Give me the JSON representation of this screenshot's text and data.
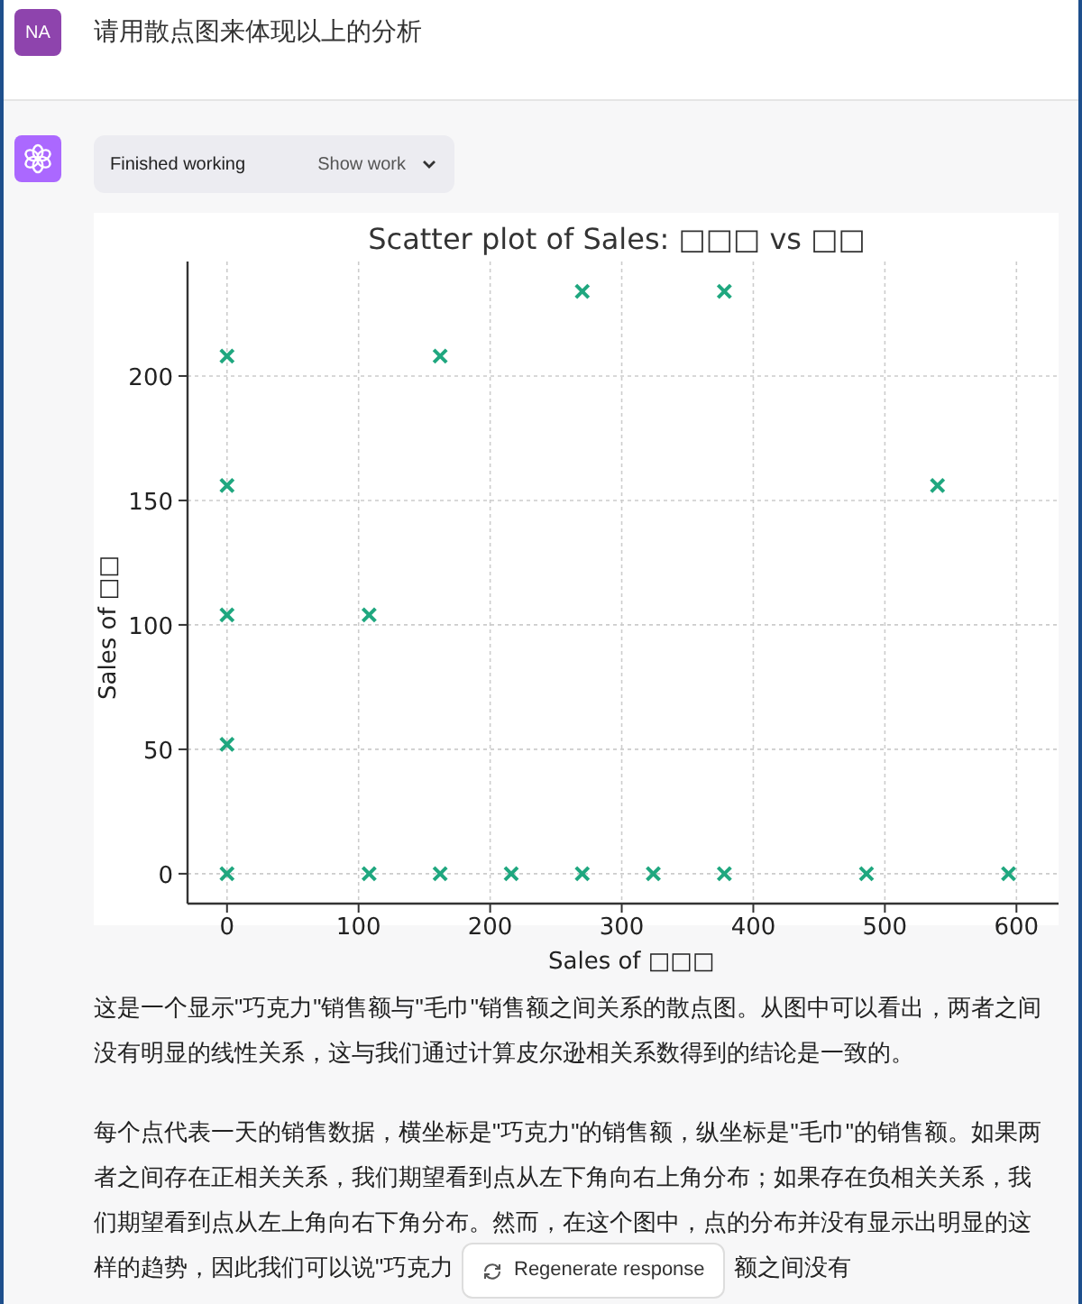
{
  "user_message": {
    "avatar": "NA",
    "text": "请用散点图来体现以上的分析"
  },
  "assistant": {
    "status": {
      "label": "Finished working",
      "toggle": "Show work",
      "expanded": false
    },
    "chart_data": {
      "type": "scatter",
      "title": "Scatter plot of Sales: □□□ vs □□",
      "xlabel": "Sales of □□□",
      "ylabel": "Sales of □□",
      "xlim": [
        -30,
        632
      ],
      "ylim": [
        -12,
        246
      ],
      "xticks": [
        0,
        100,
        200,
        300,
        400,
        500,
        600
      ],
      "yticks": [
        0,
        50,
        100,
        150,
        200
      ],
      "grid": true,
      "x": [
        0,
        0,
        0,
        0,
        0,
        108,
        108,
        162,
        162,
        216,
        270,
        270,
        324,
        378,
        378,
        486,
        540,
        594
      ],
      "series": [
        {
          "color": "#1fa77f",
          "values": [
            208,
            156,
            104,
            52,
            0,
            104,
            0,
            208,
            0,
            0,
            234,
            0,
            0,
            234,
            0,
            0,
            156,
            0
          ]
        }
      ]
    },
    "paragraphs": [
      {
        "lines": [
          [
            "这是一个显示\"巧克力\"销售额与\"毛巾\"销售额之间关系的散点图。从图中可以看出，两者之间"
          ],
          [
            "没有明显的线性关系，这与我们通过计算皮尔逊相关系数得到的结论是一致的。"
          ]
        ]
      },
      {
        "lines": [
          [
            "每个点代表一天的销售数据，横坐标是\"巧克力\"的销售额，纵坐标是\"毛巾\"的销售额。如果两"
          ],
          [
            "者之间存在正相关关系，我们期望看到点从左下角向右上角分布；如果存在负相关关系，我"
          ],
          [
            "们期望看到点从左上角向右下角分布。然而，在这个图中，点的分布并没有显示出明显的这"
          ],
          [
            "样的趋势，因此我们可以说\"巧克力",
            "额之间没有"
          ]
        ]
      }
    ]
  },
  "regenerate_button": "Regenerate response"
}
